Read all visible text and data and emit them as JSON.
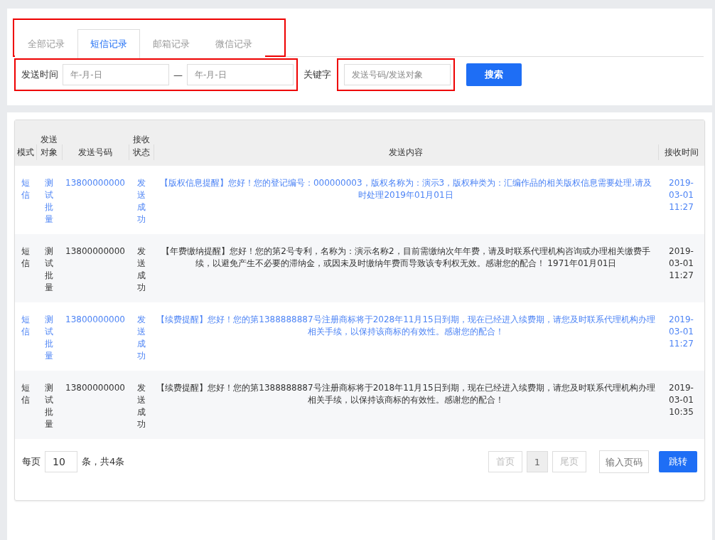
{
  "tabs": [
    {
      "label": "全部记录",
      "selected": false
    },
    {
      "label": "短信记录",
      "selected": true
    },
    {
      "label": "邮箱记录",
      "selected": false
    },
    {
      "label": "微信记录",
      "selected": false
    }
  ],
  "tabs_outlined": true,
  "filter": {
    "date_label": "发送时间",
    "date_from_placeholder": "年-月-日",
    "date_separator": "—",
    "date_to_placeholder": "年-月-日",
    "date_outlined": true,
    "keyword_label": "关键字",
    "keyword_placeholder": "发送号码/发送对象",
    "keyword_outlined": true,
    "search_button": "搜索"
  },
  "table": {
    "columns": [
      "模式",
      "发送对象",
      "发送号码",
      "接收状态",
      "发送内容",
      "接收时间"
    ],
    "rows": [
      {
        "highlighted": true,
        "cells": [
          "短信",
          "测试批量",
          "13800000000",
          "发送成功",
          "【版权信息提醒】您好！您的登记编号：000000003，版权名称为：演示3，版权种类为：汇编作品的相关版权信息需要处理,请及时处理2019年01月01日",
          "2019-03-01 11:27"
        ]
      },
      {
        "highlighted": false,
        "cells": [
          "短信",
          "测试批量",
          "13800000000",
          "发送成功",
          "【年费缴纳提醒】您好！您的第2号专利，名称为：演示名称2，目前需缴纳次年年费，请及时联系代理机构咨询或办理相关缴费手续，以避免产生不必要的滞纳金，或因未及时缴纳年费而导致该专利权无效。感谢您的配合！ 1971年01月01日",
          "2019-03-01 11:27"
        ]
      },
      {
        "highlighted": true,
        "cells": [
          "短信",
          "测试批量",
          "13800000000",
          "发送成功",
          "【续费提醒】您好！您的第1388888887号注册商标将于2028年11月15日到期，现在已经进入续费期，请您及时联系代理机构办理相关手续，以保持该商标的有效性。感谢您的配合！",
          "2019-03-01 11:27"
        ]
      },
      {
        "highlighted": false,
        "cells": [
          "短信",
          "测试批量",
          "13800000000",
          "发送成功",
          "【续费提醒】您好！您的第1388888887号注册商标将于2018年11月15日到期，现在已经进入续费期，请您及时联系代理机构办理相关手续，以保持该商标的有效性。感谢您的配合！",
          "2019-03-01 10:35"
        ]
      }
    ]
  },
  "pagination": {
    "per_page_label": "每页",
    "per_page_value": "10",
    "total_text": "条，共4条",
    "pages": [
      {
        "label": "首页",
        "disabled": true,
        "selected": false
      },
      {
        "label": "1",
        "disabled": false,
        "selected": true
      },
      {
        "label": "尾页",
        "disabled": true,
        "selected": false
      }
    ],
    "page_input_placeholder": "输入页码",
    "jump_button": "跳转"
  }
}
